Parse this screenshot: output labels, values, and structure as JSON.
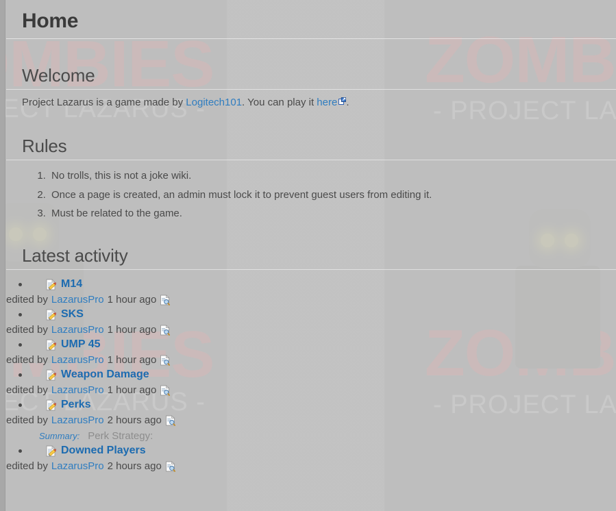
{
  "page": {
    "title": "Home"
  },
  "background": {
    "logo_main": "ZOMBIES",
    "logo_sub": "- PROJECT LAZARUS -",
    "logo_color": "#ffa8a8",
    "sub_color": "#f2f2f2",
    "eye_color": "#f2f0b0"
  },
  "colors": {
    "page_background": "#bdbdbd",
    "link": "#2f7dc0",
    "activity_link": "#1c6bb0",
    "body_text": "#4a4a4a",
    "heading": "#4b4b4b",
    "title": "#3a3a3a",
    "summary_label": "#2f7dc0",
    "summary_text": "#8d8d8d"
  },
  "welcome": {
    "heading": "Welcome",
    "text_before_author": "Project Lazarus is a game made by ",
    "author_link": "Logitech101",
    "text_middle": ". You can play it ",
    "play_link": "here",
    "text_after": "."
  },
  "rules": {
    "heading": "Rules",
    "items": [
      "No trolls, this is not a joke wiki.",
      "Once a page is created, an admin must lock it to prevent guest users from editing it.",
      "Must be related to the game."
    ]
  },
  "latest_activity": {
    "heading": "Latest activity",
    "edited_by_label": "edited by",
    "summary_label": "Summary:",
    "items": [
      {
        "title": "M14",
        "editor": "LazarusPro",
        "time": "1 hour ago",
        "summary": null
      },
      {
        "title": "SKS",
        "editor": "LazarusPro",
        "time": "1 hour ago",
        "summary": null
      },
      {
        "title": "UMP 45",
        "editor": "LazarusPro",
        "time": "1 hour ago",
        "summary": null
      },
      {
        "title": "Weapon Damage",
        "editor": "LazarusPro",
        "time": "1 hour ago",
        "summary": null
      },
      {
        "title": "Perks",
        "editor": "LazarusPro",
        "time": "2 hours ago",
        "summary": "Perk Strategy:"
      },
      {
        "title": "Downed Players",
        "editor": "LazarusPro",
        "time": "2 hours ago",
        "summary": null
      }
    ]
  },
  "icons": {
    "edit": "edit-document-pencil-icon",
    "diff": "document-diff-magnifier-icon",
    "external": "external-link-icon"
  }
}
